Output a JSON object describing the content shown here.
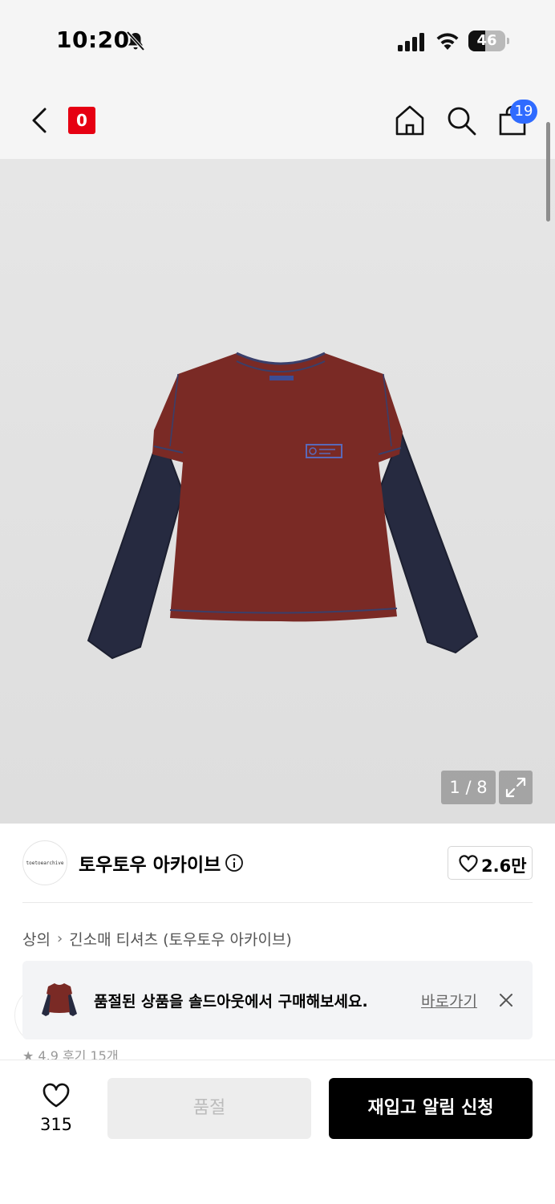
{
  "status_bar": {
    "time": "10:20",
    "battery_level": "46",
    "battery_fraction": 0.46
  },
  "nav": {
    "logo_text": "0",
    "cart_count": "19"
  },
  "gallery": {
    "counter": "1 / 8",
    "brand_tag": "toetoearchive"
  },
  "brand": {
    "avatar_text": "toetoearchive",
    "name": "토우토우 아카이브",
    "likes": "2.6만"
  },
  "breadcrumb": {
    "category": "상의",
    "subcategory": "긴소매 티셔츠 (토우토우 아카이브)"
  },
  "banner": {
    "message": "품절된 상품을 솔드아웃에서 구매해보세요.",
    "link_label": "바로가기"
  },
  "peek": {
    "text": "★ 4.9 후기 15개"
  },
  "bottom_bar": {
    "wish_count": "315",
    "soldout_label": "품절",
    "restock_label": "재입고 알림 신청"
  },
  "colors": {
    "accent_blue": "#2f6bff",
    "logo_red": "#e60012",
    "shirt_body": "#7a2a25",
    "shirt_sleeve": "#262a40"
  }
}
